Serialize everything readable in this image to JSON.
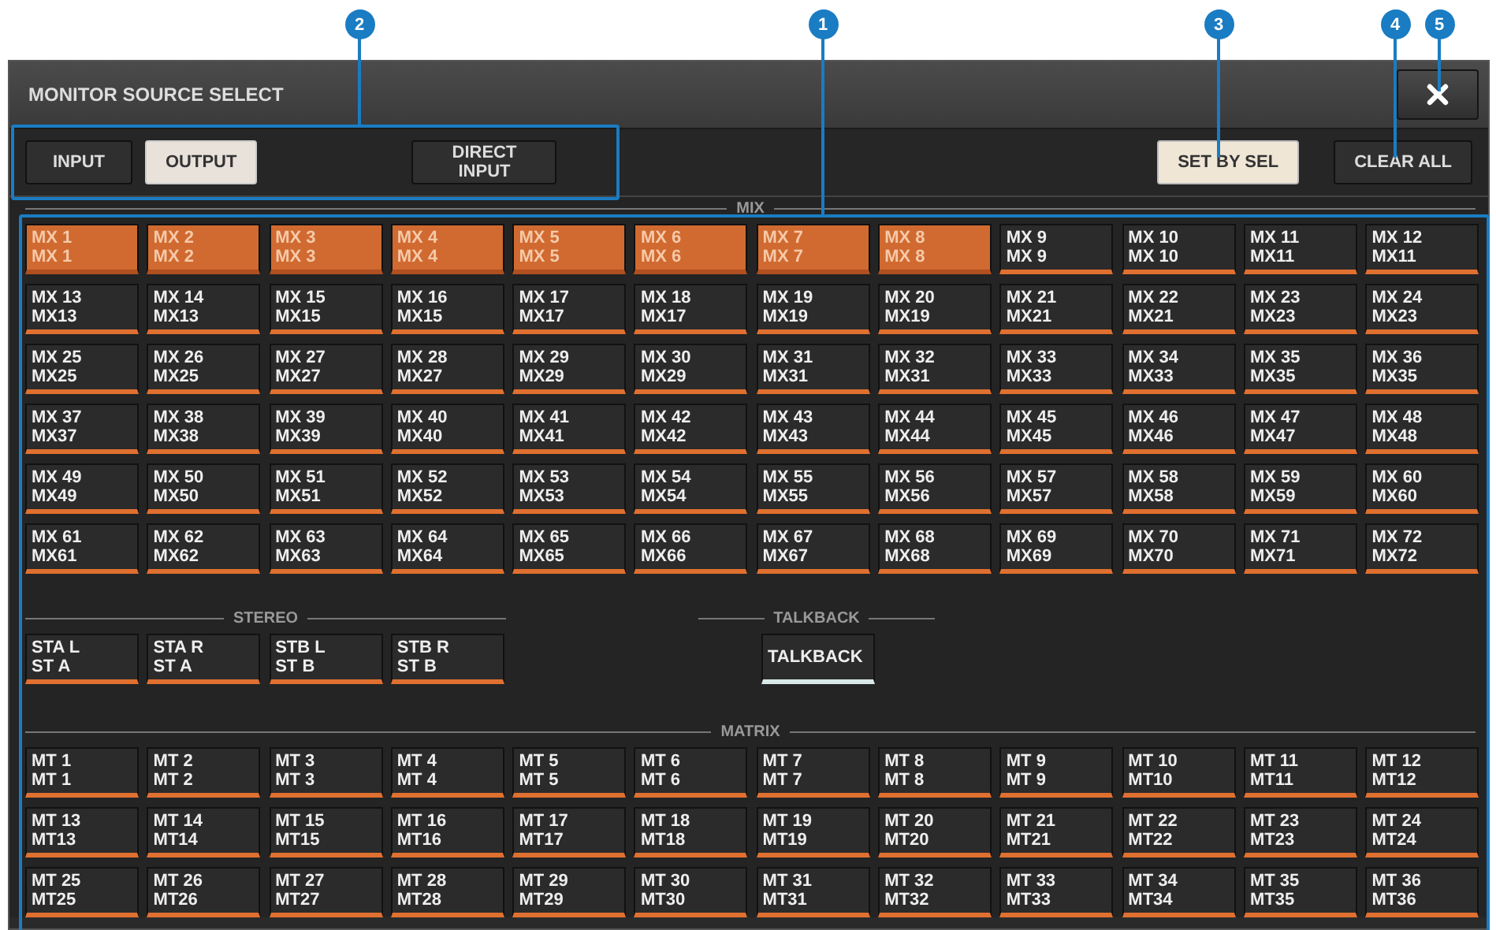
{
  "window": {
    "title": "MONITOR SOURCE SELECT"
  },
  "source_tabs": [
    {
      "label": "INPUT",
      "selected": false
    },
    {
      "label": "OUTPUT",
      "selected": true
    },
    {
      "label": "DIRECT INPUT",
      "selected": false
    }
  ],
  "toolbar_buttons": [
    {
      "label": "SET BY SEL",
      "on": true
    },
    {
      "label": "CLEAR ALL",
      "on": false
    }
  ],
  "sections": [
    {
      "kind": "full",
      "title": "MIX",
      "channels": [
        {
          "name": "MX 1",
          "sub": "MX 1",
          "selected": true
        },
        {
          "name": "MX 2",
          "sub": "MX 2",
          "selected": true
        },
        {
          "name": "MX 3",
          "sub": "MX 3",
          "selected": true
        },
        {
          "name": "MX 4",
          "sub": "MX 4",
          "selected": true
        },
        {
          "name": "MX 5",
          "sub": "MX 5",
          "selected": true
        },
        {
          "name": "MX 6",
          "sub": "MX 6",
          "selected": true
        },
        {
          "name": "MX 7",
          "sub": "MX 7",
          "selected": true
        },
        {
          "name": "MX 8",
          "sub": "MX 8",
          "selected": true
        },
        {
          "name": "MX 9",
          "sub": "MX 9",
          "selected": false
        },
        {
          "name": "MX 10",
          "sub": "MX 10",
          "selected": false
        },
        {
          "name": "MX 11",
          "sub": "MX11",
          "selected": false
        },
        {
          "name": "MX 12",
          "sub": "MX11",
          "selected": false
        },
        {
          "name": "MX 13",
          "sub": "MX13",
          "selected": false
        },
        {
          "name": "MX 14",
          "sub": "MX13",
          "selected": false
        },
        {
          "name": "MX 15",
          "sub": "MX15",
          "selected": false
        },
        {
          "name": "MX 16",
          "sub": "MX15",
          "selected": false
        },
        {
          "name": "MX 17",
          "sub": "MX17",
          "selected": false
        },
        {
          "name": "MX 18",
          "sub": "MX17",
          "selected": false
        },
        {
          "name": "MX 19",
          "sub": "MX19",
          "selected": false
        },
        {
          "name": "MX 20",
          "sub": "MX19",
          "selected": false
        },
        {
          "name": "MX 21",
          "sub": "MX21",
          "selected": false
        },
        {
          "name": "MX 22",
          "sub": "MX21",
          "selected": false
        },
        {
          "name": "MX 23",
          "sub": "MX23",
          "selected": false
        },
        {
          "name": "MX 24",
          "sub": "MX23",
          "selected": false
        },
        {
          "name": "MX 25",
          "sub": "MX25",
          "selected": false
        },
        {
          "name": "MX 26",
          "sub": "MX25",
          "selected": false
        },
        {
          "name": "MX 27",
          "sub": "MX27",
          "selected": false
        },
        {
          "name": "MX 28",
          "sub": "MX27",
          "selected": false
        },
        {
          "name": "MX 29",
          "sub": "MX29",
          "selected": false
        },
        {
          "name": "MX 30",
          "sub": "MX29",
          "selected": false
        },
        {
          "name": "MX 31",
          "sub": "MX31",
          "selected": false
        },
        {
          "name": "MX 32",
          "sub": "MX31",
          "selected": false
        },
        {
          "name": "MX 33",
          "sub": "MX33",
          "selected": false
        },
        {
          "name": "MX 34",
          "sub": "MX33",
          "selected": false
        },
        {
          "name": "MX 35",
          "sub": "MX35",
          "selected": false
        },
        {
          "name": "MX 36",
          "sub": "MX35",
          "selected": false
        },
        {
          "name": "MX 37",
          "sub": "MX37",
          "selected": false
        },
        {
          "name": "MX 38",
          "sub": "MX38",
          "selected": false
        },
        {
          "name": "MX 39",
          "sub": "MX39",
          "selected": false
        },
        {
          "name": "MX 40",
          "sub": "MX40",
          "selected": false
        },
        {
          "name": "MX 41",
          "sub": "MX41",
          "selected": false
        },
        {
          "name": "MX 42",
          "sub": "MX42",
          "selected": false
        },
        {
          "name": "MX 43",
          "sub": "MX43",
          "selected": false
        },
        {
          "name": "MX 44",
          "sub": "MX44",
          "selected": false
        },
        {
          "name": "MX 45",
          "sub": "MX45",
          "selected": false
        },
        {
          "name": "MX 46",
          "sub": "MX46",
          "selected": false
        },
        {
          "name": "MX 47",
          "sub": "MX47",
          "selected": false
        },
        {
          "name": "MX 48",
          "sub": "MX48",
          "selected": false
        },
        {
          "name": "MX 49",
          "sub": "MX49",
          "selected": false
        },
        {
          "name": "MX 50",
          "sub": "MX50",
          "selected": false
        },
        {
          "name": "MX 51",
          "sub": "MX51",
          "selected": false
        },
        {
          "name": "MX 52",
          "sub": "MX52",
          "selected": false
        },
        {
          "name": "MX 53",
          "sub": "MX53",
          "selected": false
        },
        {
          "name": "MX 54",
          "sub": "MX54",
          "selected": false
        },
        {
          "name": "MX 55",
          "sub": "MX55",
          "selected": false
        },
        {
          "name": "MX 56",
          "sub": "MX56",
          "selected": false
        },
        {
          "name": "MX 57",
          "sub": "MX57",
          "selected": false
        },
        {
          "name": "MX 58",
          "sub": "MX58",
          "selected": false
        },
        {
          "name": "MX 59",
          "sub": "MX59",
          "selected": false
        },
        {
          "name": "MX 60",
          "sub": "MX60",
          "selected": false
        },
        {
          "name": "MX 61",
          "sub": "MX61",
          "selected": false
        },
        {
          "name": "MX 62",
          "sub": "MX62",
          "selected": false
        },
        {
          "name": "MX 63",
          "sub": "MX63",
          "selected": false
        },
        {
          "name": "MX 64",
          "sub": "MX64",
          "selected": false
        },
        {
          "name": "MX 65",
          "sub": "MX65",
          "selected": false
        },
        {
          "name": "MX 66",
          "sub": "MX66",
          "selected": false
        },
        {
          "name": "MX 67",
          "sub": "MX67",
          "selected": false
        },
        {
          "name": "MX 68",
          "sub": "MX68",
          "selected": false
        },
        {
          "name": "MX 69",
          "sub": "MX69",
          "selected": false
        },
        {
          "name": "MX 70",
          "sub": "MX70",
          "selected": false
        },
        {
          "name": "MX 71",
          "sub": "MX71",
          "selected": false
        },
        {
          "name": "MX 72",
          "sub": "MX72",
          "selected": false
        }
      ]
    },
    {
      "kind": "stereo",
      "title": "STEREO",
      "channels": [
        {
          "name": "STA L",
          "sub": "ST A",
          "selected": false
        },
        {
          "name": "STA R",
          "sub": "ST A",
          "selected": false
        },
        {
          "name": "STB L",
          "sub": "ST B",
          "selected": false
        },
        {
          "name": "STB R",
          "sub": "ST B",
          "selected": false
        }
      ]
    },
    {
      "kind": "talkback",
      "title": "TALKBACK",
      "channels": [
        {
          "name": "TALKBACK",
          "selected": false
        }
      ]
    },
    {
      "kind": "full",
      "title": "MATRIX",
      "channels": [
        {
          "name": "MT 1",
          "sub": "MT 1",
          "selected": false
        },
        {
          "name": "MT 2",
          "sub": "MT 2",
          "selected": false
        },
        {
          "name": "MT 3",
          "sub": "MT 3",
          "selected": false
        },
        {
          "name": "MT 4",
          "sub": "MT 4",
          "selected": false
        },
        {
          "name": "MT 5",
          "sub": "MT 5",
          "selected": false
        },
        {
          "name": "MT 6",
          "sub": "MT 6",
          "selected": false
        },
        {
          "name": "MT 7",
          "sub": "MT 7",
          "selected": false
        },
        {
          "name": "MT 8",
          "sub": "MT 8",
          "selected": false
        },
        {
          "name": "MT 9",
          "sub": "MT 9",
          "selected": false
        },
        {
          "name": "MT 10",
          "sub": "MT10",
          "selected": false
        },
        {
          "name": "MT 11",
          "sub": "MT11",
          "selected": false
        },
        {
          "name": "MT 12",
          "sub": "MT12",
          "selected": false
        },
        {
          "name": "MT 13",
          "sub": "MT13",
          "selected": false
        },
        {
          "name": "MT 14",
          "sub": "MT14",
          "selected": false
        },
        {
          "name": "MT 15",
          "sub": "MT15",
          "selected": false
        },
        {
          "name": "MT 16",
          "sub": "MT16",
          "selected": false
        },
        {
          "name": "MT 17",
          "sub": "MT17",
          "selected": false
        },
        {
          "name": "MT 18",
          "sub": "MT18",
          "selected": false
        },
        {
          "name": "MT 19",
          "sub": "MT19",
          "selected": false
        },
        {
          "name": "MT 20",
          "sub": "MT20",
          "selected": false
        },
        {
          "name": "MT 21",
          "sub": "MT21",
          "selected": false
        },
        {
          "name": "MT 22",
          "sub": "MT22",
          "selected": false
        },
        {
          "name": "MT 23",
          "sub": "MT23",
          "selected": false
        },
        {
          "name": "MT 24",
          "sub": "MT24",
          "selected": false
        },
        {
          "name": "MT 25",
          "sub": "MT25",
          "selected": false
        },
        {
          "name": "MT 26",
          "sub": "MT26",
          "selected": false
        },
        {
          "name": "MT 27",
          "sub": "MT27",
          "selected": false
        },
        {
          "name": "MT 28",
          "sub": "MT28",
          "selected": false
        },
        {
          "name": "MT 29",
          "sub": "MT29",
          "selected": false
        },
        {
          "name": "MT 30",
          "sub": "MT30",
          "selected": false
        },
        {
          "name": "MT 31",
          "sub": "MT31",
          "selected": false
        },
        {
          "name": "MT 32",
          "sub": "MT32",
          "selected": false
        },
        {
          "name": "MT 33",
          "sub": "MT33",
          "selected": false
        },
        {
          "name": "MT 34",
          "sub": "MT34",
          "selected": false
        },
        {
          "name": "MT 35",
          "sub": "MT35",
          "selected": false
        },
        {
          "name": "MT 36",
          "sub": "MT36",
          "selected": false
        }
      ]
    }
  ],
  "callouts": [
    {
      "label": "2"
    },
    {
      "label": "1"
    },
    {
      "label": "3"
    },
    {
      "label": "4"
    },
    {
      "label": "5"
    }
  ]
}
